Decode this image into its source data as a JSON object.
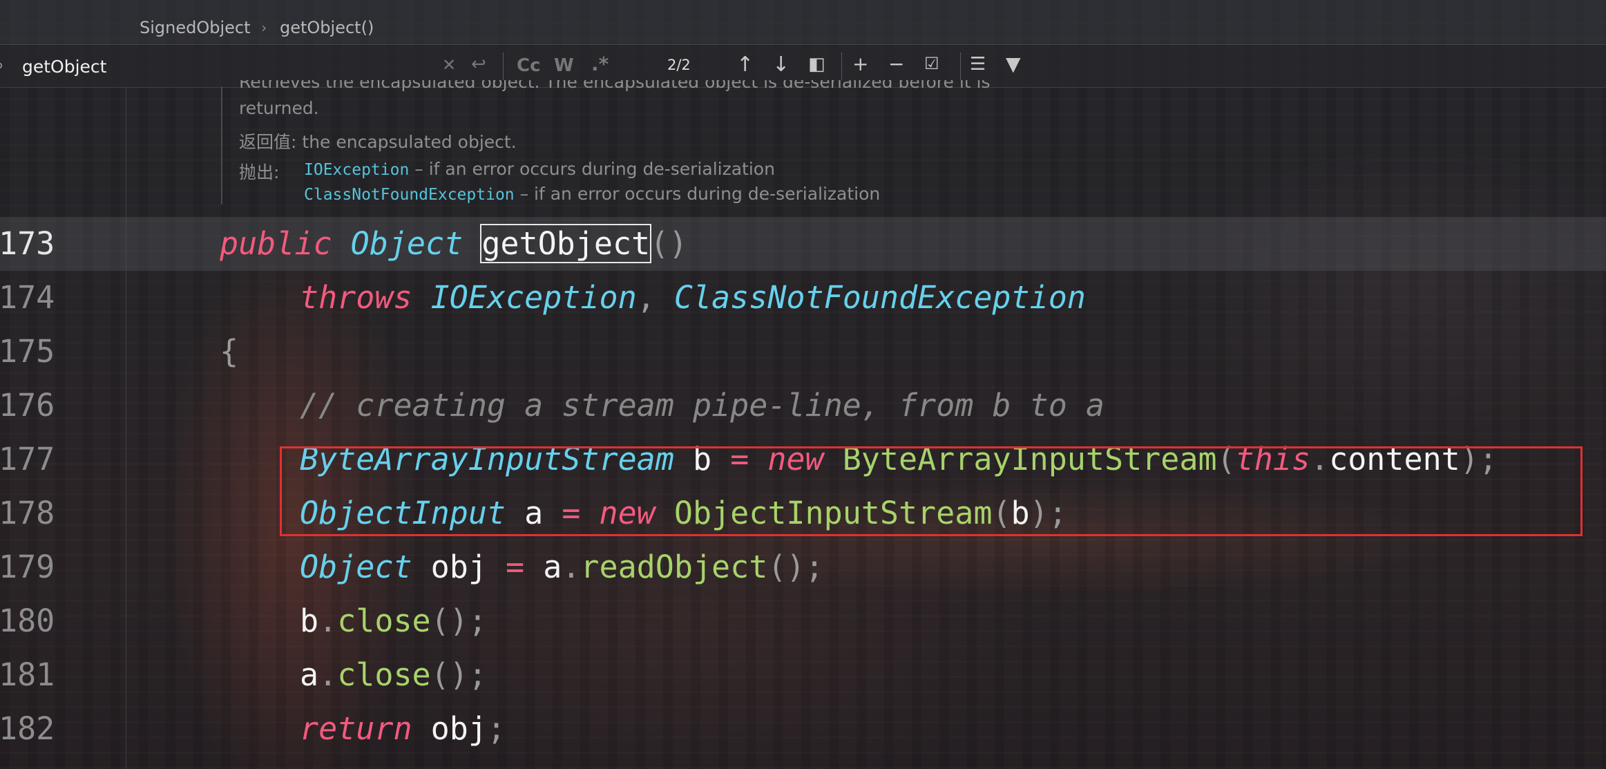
{
  "breadcrumbs": [
    "SignedObject",
    "getObject()"
  ],
  "search": {
    "query": "getObject",
    "match_count": "2/2",
    "icons": [
      "search-icon",
      "clear-icon",
      "history-icon",
      "match-case-icon",
      "whole-word-icon",
      "regex-icon",
      "previous-occurrence-icon",
      "next-occurrence-icon",
      "open-in-window-icon",
      "add-selection-icon",
      "remove-selection-icon",
      "select-all-occurrences-icon",
      "filter-search-icon",
      "funnel-icon"
    ],
    "case_label": "Cc",
    "word_label": "W",
    "regex_label": ".*"
  },
  "doc": {
    "line1": "Retrieves the encapsulated object. The encapsulated object is de-serialized before it is",
    "line2": "returned.",
    "returns_label": "返回值:",
    "returns_text": "the encapsulated object.",
    "throws_label": "抛出:",
    "throws": [
      {
        "type": "IOException",
        "text": " – if an error occurs during de-serialization"
      },
      {
        "type": "ClassNotFoundException",
        "text": " – if an error occurs during de-serialization"
      }
    ]
  },
  "line_numbers": [
    "173",
    "174",
    "175",
    "176",
    "177",
    "178",
    "179",
    "180",
    "181",
    "182"
  ],
  "code": {
    "l173": {
      "kw": "public",
      "type": "Object",
      "name": "getObject",
      "parens": "()"
    },
    "l174": {
      "kw": "throws",
      "t1": "IOException",
      "comma": ",",
      "t2": "ClassNotFoundException"
    },
    "l175": {
      "brace": "{"
    },
    "l176": {
      "comment": "// creating a stream pipe-line, from b to a"
    },
    "l177": {
      "type": "ByteArrayInputStream",
      "var": "b",
      "eq": "=",
      "kw": "new",
      "ctor": "ByteArrayInputStream",
      "open": "(",
      "this": "this",
      "dot": ".",
      "field": "content",
      "close": ");"
    },
    "l178": {
      "type": "ObjectInput",
      "var": "a",
      "eq": "=",
      "kw": "new",
      "ctor": "ObjectInputStream",
      "open": "(",
      "arg": "b",
      "close": ");"
    },
    "l179": {
      "type": "Object",
      "var": "obj",
      "eq": "=",
      "recv": "a",
      "dot": ".",
      "call": "readObject",
      "close": "();"
    },
    "l180": {
      "recv": "b",
      "dot": ".",
      "call": "close",
      "close": "();"
    },
    "l181": {
      "recv": "a",
      "dot": ".",
      "call": "close",
      "close": "();"
    },
    "l182": {
      "kw": "return",
      "var": "obj",
      "semi": ";"
    }
  },
  "colors": {
    "keyword": "#f25a7e",
    "type": "#66d1ec",
    "function": "#a7d36a",
    "comment": "#888888",
    "highlight_box": "#e03131"
  }
}
